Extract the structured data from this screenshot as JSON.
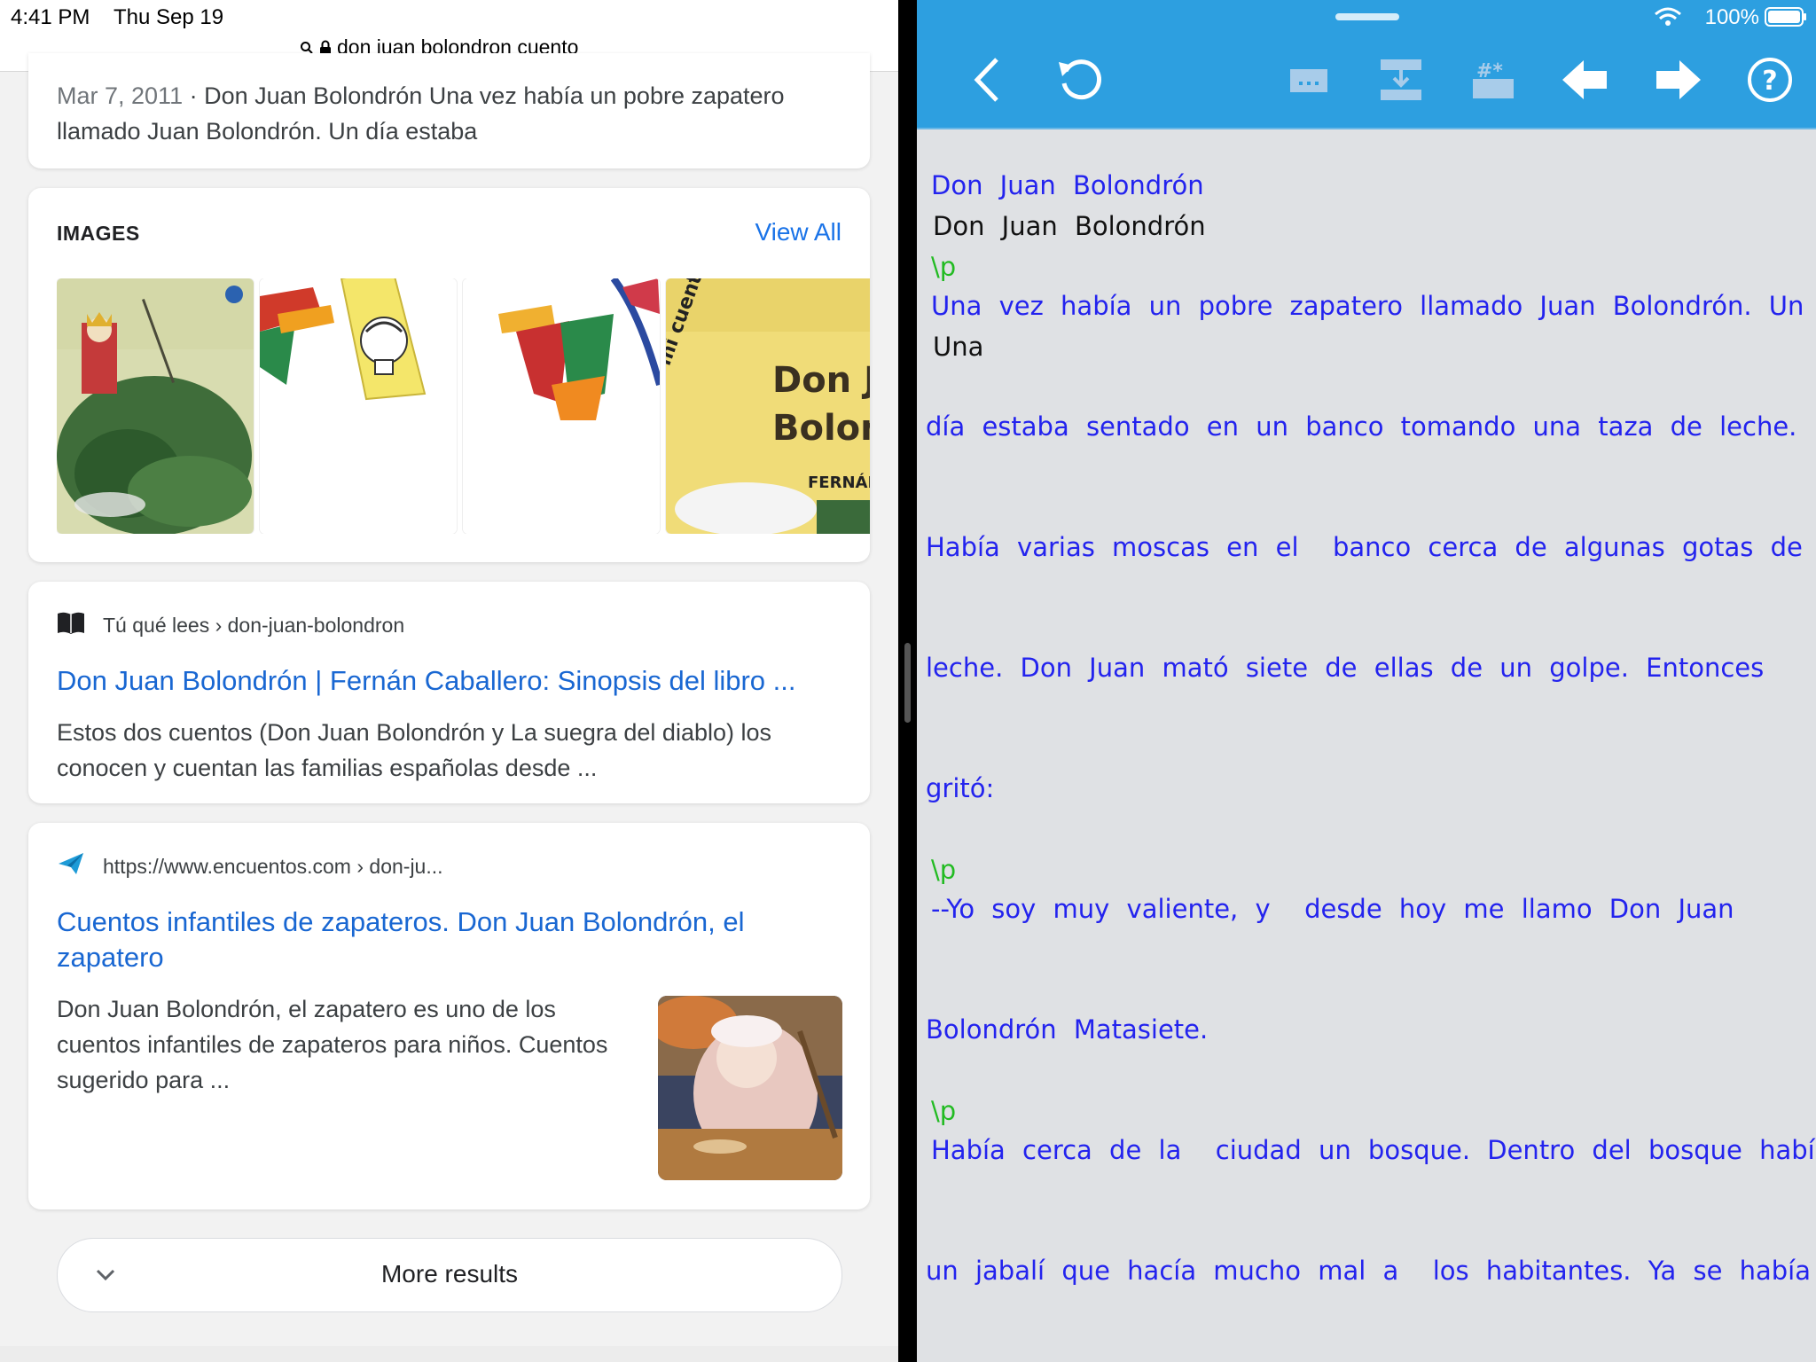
{
  "left": {
    "status": {
      "time": "4:41 PM",
      "date": "Thu Sep 19"
    },
    "url": "don juan bolondron cuento",
    "snippet": {
      "date": "Mar 7, 2011",
      "text": " · Don Juan Bolondrón Una vez había un pobre zapatero llamado Juan Bolondrón. Un día estaba"
    },
    "images": {
      "title": "IMAGES",
      "view_all": "View All"
    },
    "result1": {
      "source": "Tú qué lees › don-juan-bolondron",
      "title": "Don Juan Bolondrón | Fernán Caballero: Sinopsis del libro ...",
      "body": "Estos dos cuentos (Don Juan Bolondrón y La suegra del diablo) los conocen y cuentan las familias españolas desde ..."
    },
    "result2": {
      "source": "https://www.encuentos.com › don-ju...",
      "title": "Cuentos infantiles de zapateros. Don Juan Bolondrón, el zapatero",
      "body": "Don Juan Bolondrón, el zapatero es uno de los cuentos infantiles de zapateros para niños. Cuentos sugerido para ..."
    },
    "more_results": "More results"
  },
  "right": {
    "status": {
      "battery": "100%"
    },
    "toolbar_icons": [
      "back-chevron-icon",
      "refresh-icon",
      "keyboard-icon",
      "merge-icon",
      "hash-icon",
      "left-arrow-icon",
      "right-arrow-icon",
      "help-icon"
    ],
    "lines": [
      "Don Juan Bolondrón",
      "Don Juan Bolondrón",
      "\\p",
      "Una vez había un pobre zapatero llamado Juan Bolondrón. Un",
      "Una",
      "día estaba sentado en un banco tomando una taza de leche.",
      "Había varias moscas en el  banco cerca de algunas gotas de",
      "leche. Don Juan mató siete de ellas de un golpe. Entonces",
      "gritó:",
      "\\p",
      "--Yo soy muy valiente, y  desde hoy me llamo Don Juan",
      "Bolondrón Matasiete.",
      "\\p",
      "Había cerca de la  ciudad un bosque. Dentro del bosque había",
      "un jabalí que hacía mucho mal a  los habitantes. Ya se había"
    ]
  },
  "colors": {
    "link_blue": "#1967d2",
    "toolbar_blue": "#2d9fe0",
    "reader_bg": "#dfe1e4",
    "text_blue": "#2323ee",
    "marker_green": "#22bb22"
  }
}
